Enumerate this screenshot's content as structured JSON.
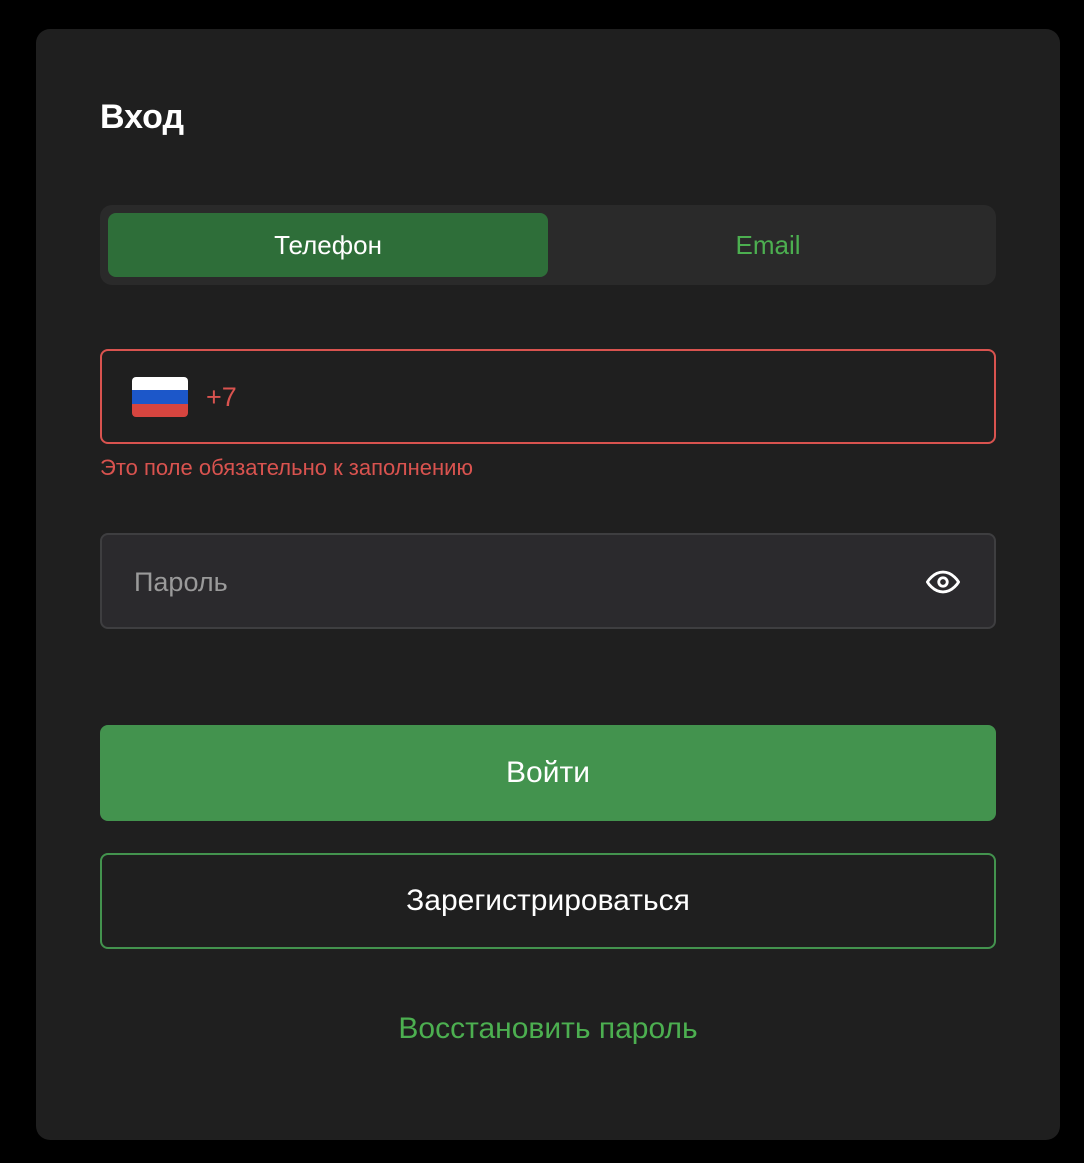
{
  "login": {
    "title": "Вход",
    "tabs": [
      {
        "label": "Телефон",
        "active": true
      },
      {
        "label": "Email",
        "active": false
      }
    ],
    "phone": {
      "country_icon": "russia-flag-icon",
      "prefix": "+7",
      "value": "",
      "error": "Это поле обязательно к заполнению"
    },
    "password": {
      "placeholder": "Пароль",
      "value": "",
      "toggle_icon": "eye-icon"
    },
    "login_button": "Войти",
    "register_button": "Зарегистрироваться",
    "recover_link": "Восстановить пароль"
  },
  "colors": {
    "background": "#000000",
    "card": "#1f1f1f",
    "accent": "#43934e",
    "active_tab": "#2e6e39",
    "link": "#4caf50",
    "error": "#d9534f"
  }
}
